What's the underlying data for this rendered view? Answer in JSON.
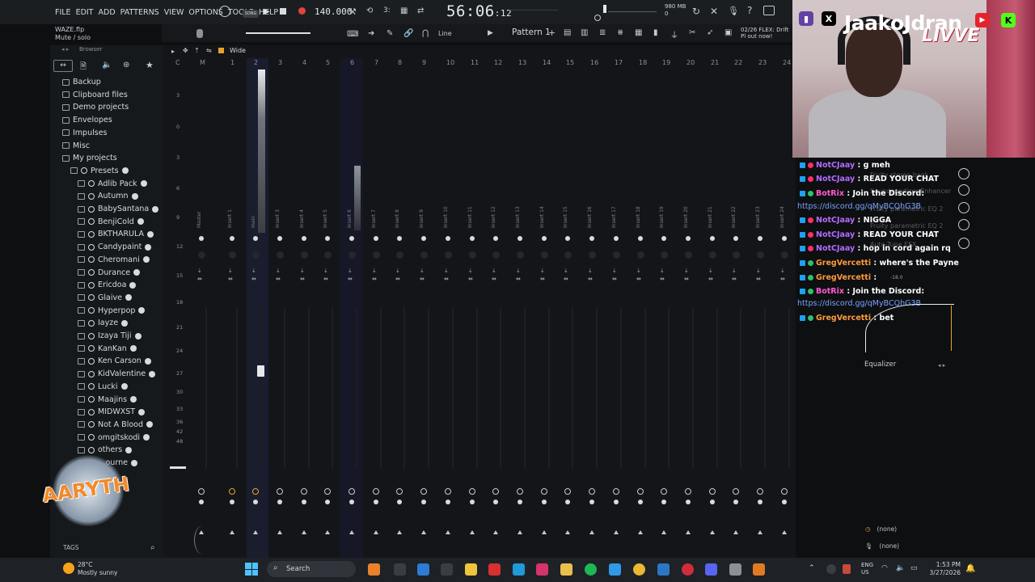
{
  "menu": [
    "FILE",
    "EDIT",
    "ADD",
    "PATTERNS",
    "VIEW",
    "OPTIONS",
    "TOOLS",
    "HELP"
  ],
  "song_badge": "SONG",
  "tempo": "140.000",
  "clock": "56:06",
  "clock_small": ":12",
  "memory": {
    "line1": "980 MB",
    "line2": "0"
  },
  "project": {
    "file": "WAZE.flp",
    "hint": "Mute / solo"
  },
  "snap_mode": "Line",
  "pattern": "Pattern 1",
  "news": "02/26  FLEX: Drift Pl out now!",
  "mixer_mode": "Wide",
  "browser": {
    "title": "Browser",
    "folders": [
      "Backup",
      "Clipboard files",
      "Demo projects",
      "Envelopes",
      "Impulses",
      "Misc",
      "My projects"
    ],
    "presets_label": "Presets",
    "presets": [
      "Adlib Pack",
      "Autumn",
      "BabySantana",
      "BenjiCold",
      "BKTHARULA",
      "Candypaint",
      "Cheromani",
      "Durance",
      "Ericdoa",
      "Glaive",
      "Hyperpop",
      "Iayze",
      "Izaya Tiji",
      "KanKan",
      "Ken Carson",
      "KidValentine",
      "Lucki",
      "Maajins",
      "MIDWXST",
      "Not A Blood",
      "omgitskodi",
      "others",
      "…ourne"
    ],
    "tags_label": "TAGS"
  },
  "mixer": {
    "ruler": [
      "C",
      "M",
      "1",
      "2",
      "3",
      "4",
      "5",
      "6",
      "7",
      "8",
      "9",
      "10",
      "11",
      "12",
      "13",
      "14",
      "15",
      "16",
      "17",
      "18",
      "19",
      "20",
      "21",
      "22",
      "23",
      "24"
    ],
    "tracks": [
      "Master",
      "Insert 1",
      "main",
      "Insert 3",
      "Insert 4",
      "Insert 5",
      "Insert 6",
      "Insert 7",
      "Insert 8",
      "Insert 9",
      "Insert 10",
      "Insert 11",
      "Insert 12",
      "Insert 13",
      "Insert 14",
      "Insert 15",
      "Insert 16",
      "Insert 17",
      "Insert 18",
      "Insert 19",
      "Insert 20",
      "Insert 21",
      "Insert 22",
      "Insert 23",
      "Insert 24"
    ],
    "scale": [
      "3",
      "0",
      "3",
      "6",
      "9",
      "12",
      "15",
      "18",
      "21",
      "24",
      "27",
      "30",
      "33",
      "36",
      "42",
      "48"
    ]
  },
  "stream": {
    "channel": "JaakoJdran",
    "live": "LIVVE",
    "chat": [
      {
        "user": "NotCJaay",
        "msg": "g meh",
        "color": "#b46bff"
      },
      {
        "user": "NotCJaay",
        "msg": "READ YOUR CHAT",
        "color": "#b46bff"
      },
      {
        "user": "BotRix",
        "msg": "Join the Discord:",
        "color": "#ff5ad0"
      },
      {
        "user": "",
        "msg": "https://discord.gg/qMyBCQhG3B",
        "color": "#7aa3ff",
        "link": true
      },
      {
        "user": "NotCJaay",
        "msg": "NIGGA",
        "color": "#b46bff"
      },
      {
        "user": "NotCJaay",
        "msg": "READ YOUR CHAT",
        "color": "#b46bff"
      },
      {
        "user": "NotCJaay",
        "msg": "hop in cord again rq",
        "color": "#b46bff"
      },
      {
        "user": "GregVercetti",
        "msg": "where's the Payne",
        "color": "#ff9a3a"
      },
      {
        "user": "GregVercetti",
        "msg": "",
        "color": "#ff9a3a"
      },
      {
        "user": "BotRix",
        "msg": "Join the Discord:",
        "color": "#ff5ad0"
      },
      {
        "user": "",
        "msg": "https://discord.gg/qMyBCQhG3B",
        "color": "#7aa3ff",
        "link": true
      },
      {
        "user": "GregVercetti",
        "msg": "bet",
        "color": "#ff9a3a"
      }
    ],
    "ghost_slots": [
      "Fruity stereo bank",
      "Soundgoodizer Enhancer",
      "Fruity parametric EQ 2",
      "Fruity parametric EQ 2",
      "Auto-Tune EFX"
    ]
  },
  "fx": {
    "eq_label": "Equalizer",
    "send1": "(none)",
    "send2": "(none)",
    "vol_readout": "-18.0"
  },
  "overlay_logo": "AARYTH",
  "taskbar": {
    "weather_temp": "28°C",
    "weather_desc": "Mostly sunny",
    "search": "Search",
    "lang1": "ENG",
    "lang2": "US",
    "time": "1:53 PM",
    "date": "3/27/2026"
  }
}
